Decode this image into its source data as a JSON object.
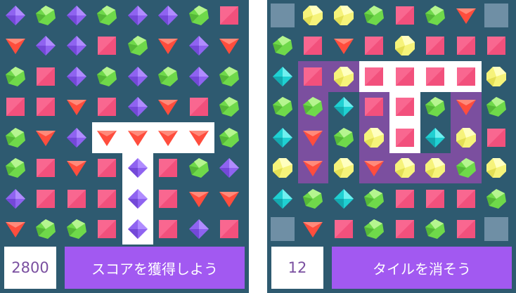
{
  "colors": {
    "background": "#2e5a70",
    "selection_fill": "#ffffff",
    "highlight_fill": "#7b4f9f",
    "button": "#a259f1",
    "score_text": "#7a4fa0"
  },
  "gem_types": {
    "B": "blue-diamond",
    "G": "green-octagon",
    "P": "pink-square",
    "R": "red-triangle",
    "Y": "yellow-octagon",
    "C": "cyan-diamond",
    "S": "stone-tile"
  },
  "left_game": {
    "score": "2800",
    "goal_label": "スコアを獲得しよう",
    "board": [
      "BGBGBBGP",
      "RBBPGRBR",
      "GPBGBGBG",
      "PPRPBRPG",
      "GRBRRRRG",
      "GPRPBPGB",
      "BPPPBPRR",
      "RGGPBPBP"
    ],
    "selected_cells": [
      [
        4,
        3
      ],
      [
        4,
        4
      ],
      [
        4,
        5
      ],
      [
        4,
        6
      ],
      [
        5,
        4
      ],
      [
        6,
        4
      ],
      [
        7,
        4
      ]
    ],
    "highlighted_cells": []
  },
  "right_game": {
    "score": "12",
    "goal_label": "タイルを消そう",
    "board": [
      "SYYGPGRS",
      "GPRPYPPP",
      "CPYPPPPY",
      "GGCPPGRG",
      "CRGYPCYP",
      "YRYRYYGY",
      "CGCGPPPG",
      "SRPGPGPS"
    ],
    "selected_cells": [
      [
        2,
        3
      ],
      [
        2,
        4
      ],
      [
        2,
        5
      ],
      [
        2,
        6
      ],
      [
        3,
        4
      ],
      [
        4,
        4
      ]
    ],
    "highlighted_cells": [
      [
        2,
        1
      ],
      [
        3,
        1
      ],
      [
        4,
        1
      ],
      [
        5,
        1
      ],
      [
        2,
        2
      ],
      [
        3,
        3
      ],
      [
        4,
        3
      ],
      [
        5,
        3
      ],
      [
        3,
        6
      ],
      [
        4,
        6
      ],
      [
        5,
        6
      ],
      [
        5,
        4
      ],
      [
        5,
        5
      ]
    ]
  }
}
